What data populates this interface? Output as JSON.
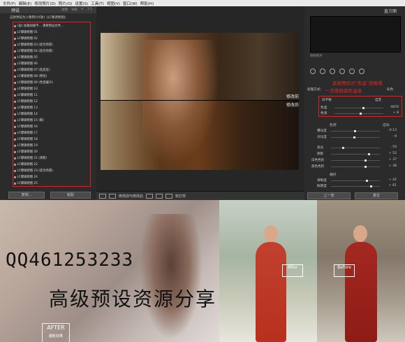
{
  "menu": [
    "文件(F)",
    "编辑(E)",
    "修改照片(D)",
    "照片(O)",
    "设置(S)",
    "工具(T)",
    "视图(V)",
    "窗口(W)",
    "帮助(H)"
  ],
  "left_panel": {
    "title": "预设",
    "tabs": [
      "滤镜",
      "导航",
      "✕",
      "1:1"
    ],
    "folder_label": "这款预设为人像用(XX款)《LF摩调修图》",
    "presets": [
      "(说) 加载如果不... 请将预设文件...",
      "LF摩调修图 01",
      "LF摩调修图 02",
      "LF摩调修图 03 (适合场景)",
      "LF摩调修图 04 (适合场景)",
      "LF摩调修图 05",
      "LF摩调修图 06",
      "LF摩调修图 07 (低反差)",
      "LF摩调修图 08 (明亮)",
      "LF摩调修图 09 (色温偏冷)",
      "LF摩调修图 10",
      "LF摩调修图 11",
      "LF摩调修图 12",
      "LF摩调修图 13",
      "LF摩调修图 14",
      "LF摩调修图 15 (暖)",
      "LF摩调修图 16",
      "LF摩调修图 17",
      "LF摩调修图 18",
      "LF摩调修图 19",
      "LF摩调修图 20",
      "LF摩调修图 21 (清新)",
      "LF摩调修图 22",
      "LF摩调修图 23 (适合场景)",
      "LF摩调修图 24",
      "LF摩调修图 25"
    ],
    "copy_button": "复制...",
    "paste_button": "粘贴"
  },
  "center": {
    "before_label": "修改前",
    "after_label": "修改后",
    "toolbar_label": "修改前与修改后",
    "soft_proof_label": "软打样"
  },
  "right_panel": {
    "histogram_label": "直方图",
    "original_label": "原始照片",
    "annotation_line1": "这款预设对“色温”很敏感",
    "annotation_line2": "一定要微调色温值",
    "profile_label": "处理方式：",
    "profile_value": "彩色",
    "wb_label": "白平衡",
    "wb_value": "自定",
    "temp_label": "色温",
    "temp_value": "4870",
    "tint_label": "色调",
    "tint_value": "+ 8",
    "tone_section": "色调",
    "tone_auto": "自动",
    "exposure_label": "曝光度",
    "exposure_value": "- 0.13",
    "contrast_label": "对比度",
    "contrast_value": "- 9",
    "highlights_label": "高光",
    "highlights_value": "- 54",
    "shadows_label": "阴影",
    "shadows_value": "+ 52",
    "whites_label": "白色色阶",
    "whites_value": "+ 37",
    "blacks_label": "黑色色阶",
    "blacks_value": "+ 38",
    "presence_section": "偏好",
    "clarity_label": "清晰度",
    "clarity_value": "+ 42",
    "vibrance_label": "鲜艳度",
    "vibrance_value": "+ 61",
    "prev_button": "上一张",
    "reset_button": "复位"
  },
  "banner": {
    "qq": "QQ461253233",
    "share": "高级预设资源分享",
    "after_badge_line1": "AFTER",
    "after_badge_line2": "摄影效果",
    "after_tag": "After",
    "before_tag": "Before"
  }
}
